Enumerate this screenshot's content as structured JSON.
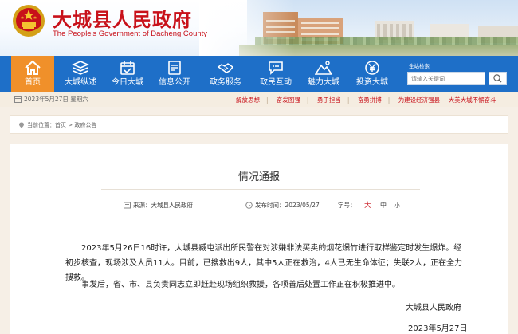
{
  "site": {
    "name": "大城县人民政府",
    "name_en": "The People's Government of Dacheng County"
  },
  "nav": {
    "items": [
      {
        "label": "首页",
        "icon": "home-icon",
        "active": true
      },
      {
        "label": "大城纵述",
        "icon": "layers-icon",
        "active": false
      },
      {
        "label": "今日大城",
        "icon": "calendar-check-icon",
        "active": false
      },
      {
        "label": "信息公开",
        "icon": "document-icon",
        "active": false
      },
      {
        "label": "政务服务",
        "icon": "handshake-icon",
        "active": false
      },
      {
        "label": "政民互动",
        "icon": "chat-icon",
        "active": false
      },
      {
        "label": "魅力大城",
        "icon": "mountain-icon",
        "active": false
      },
      {
        "label": "投资大城",
        "icon": "yen-icon",
        "active": false
      }
    ]
  },
  "search": {
    "title": "全站检索",
    "placeholder": "请输入关键词"
  },
  "infobar": {
    "date": "2023年5月27日 星期六",
    "links": [
      "解放思想",
      "奋发图强",
      "勇于担当",
      "奋勇拼搏",
      "为建设经济强县",
      "大美大城不懈奋斗"
    ]
  },
  "breadcrumb": {
    "text": "当前位置：首页 > 政府公告"
  },
  "article": {
    "title": "情况通报",
    "source_label": "来源：大城县人民政府",
    "publish_label": "发布时间：2023/05/27",
    "font_size_label": "字号：",
    "font_sizes": [
      "大",
      "中",
      "小"
    ],
    "paragraphs": [
      "2023年5月26日16时许，大城县臧屯派出所民警在对涉嫌非法买卖的烟花爆竹进行取样鉴定时发生爆炸。经初步核查，现场涉及人员11人。目前，已搜救出9人，其中5人正在救治，4人已无生命体征；失联2人，正在全力搜救。",
      "事发后，省、市、县负责同志立即赶赴现场组织救援，各项善后处置工作正在积极推进中。"
    ],
    "signature": "大城县人民政府",
    "sign_date": "2023年5月27日"
  },
  "colors": {
    "brand_red": "#c8111a",
    "nav_blue": "#1e6fc8",
    "nav_active": "#f0902a"
  }
}
